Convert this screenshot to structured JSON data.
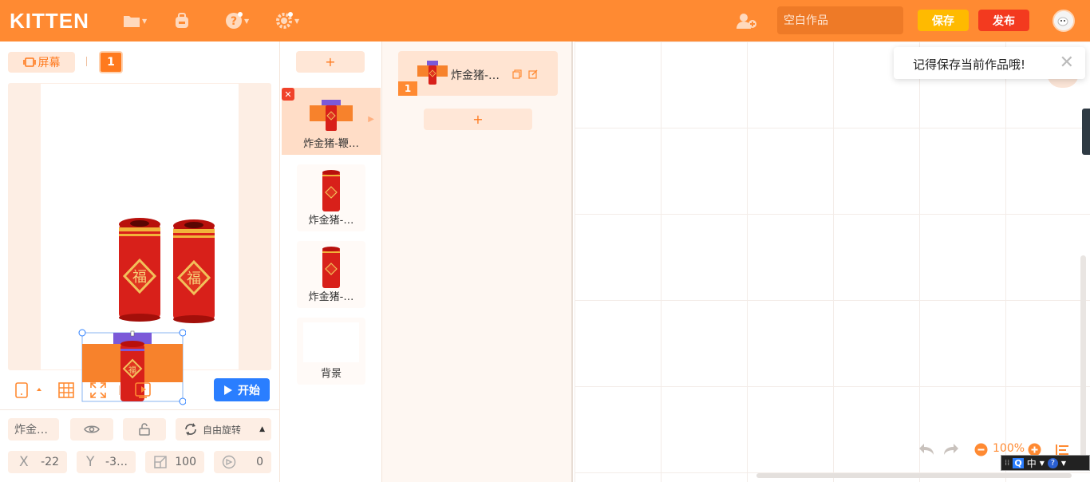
{
  "header": {
    "logo": "KITTEN",
    "work_title_placeholder": "空白作品",
    "save_label": "保存",
    "publish_label": "发布"
  },
  "stage_panel": {
    "screen_label": "屏幕",
    "page_number": "1",
    "start_label": "开始"
  },
  "properties": {
    "name": "炸金…",
    "rotation_mode": "自由旋转",
    "x_label": "X",
    "x": "-22",
    "y_label": "Y",
    "y": "-3…",
    "scale": "100",
    "direction": "0"
  },
  "sprites": [
    {
      "name": "炸金猪-鞭…",
      "selected": true
    },
    {
      "name": "炸金猪-…",
      "selected": false
    },
    {
      "name": "炸金猪-…",
      "selected": false
    },
    {
      "name": "背景",
      "selected": false
    }
  ],
  "add_label": "+",
  "scripts": [
    {
      "name": "炸金猪-…",
      "number": "1"
    }
  ],
  "toast": {
    "message": "记得保存当前作品哦!"
  },
  "zoom": {
    "level": "100%"
  },
  "ime": {
    "mode": "中"
  },
  "colors": {
    "brand": "#ff8a32",
    "save": "#ffba00",
    "publish": "#f33a1f",
    "start": "#2a7eff"
  }
}
